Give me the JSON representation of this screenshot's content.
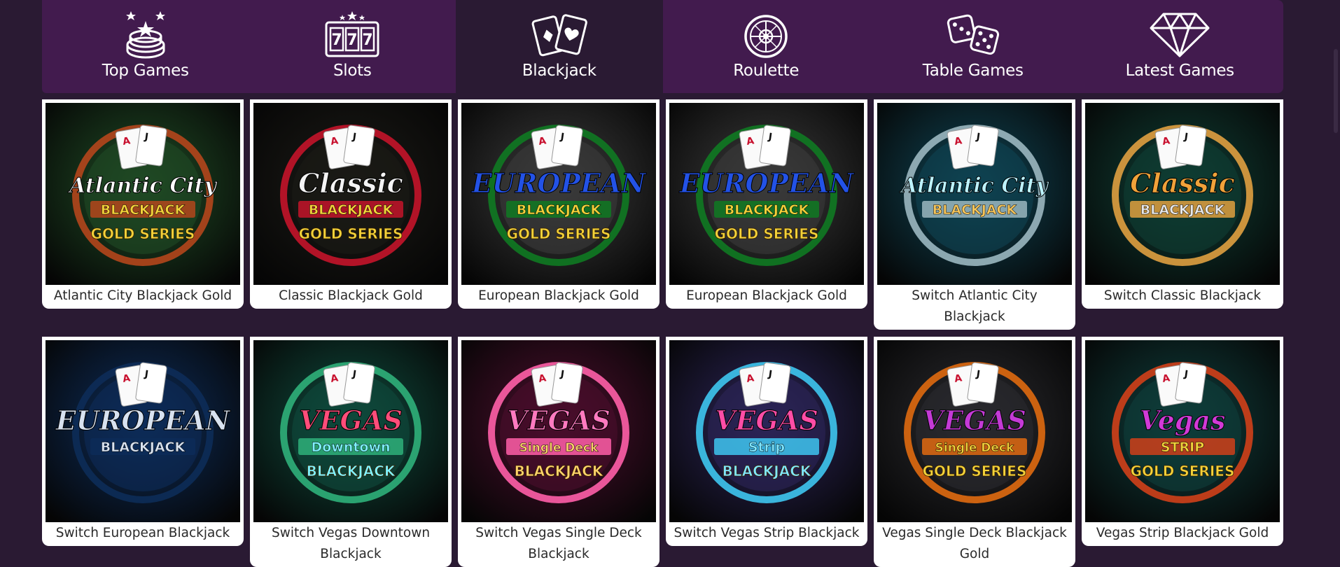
{
  "nav": {
    "tabs": [
      {
        "label": "Top Games",
        "icon": "poker-chips-icon",
        "active": false
      },
      {
        "label": "Slots",
        "icon": "slot-777-icon",
        "active": false
      },
      {
        "label": "Blackjack",
        "icon": "playing-cards-icon",
        "active": true
      },
      {
        "label": "Roulette",
        "icon": "roulette-wheel-icon",
        "active": false
      },
      {
        "label": "Table Games",
        "icon": "dice-icon",
        "active": false
      },
      {
        "label": "Latest Games",
        "icon": "diamond-icon",
        "active": false
      }
    ]
  },
  "games": [
    {
      "title": "Atlantic City Blackjack Gold",
      "art": {
        "line1": "Atlantic City",
        "line2": "BLACKJACK",
        "line3": "GOLD SERIES",
        "bg": "#1f4a24",
        "ring": "#b4461c",
        "color1": "#ffffff",
        "color2": "#f3d23a"
      }
    },
    {
      "title": "Classic Blackjack Gold",
      "art": {
        "line1": "Classic",
        "line2": "BLACKJACK",
        "line3": "GOLD SERIES",
        "bg": "#1b1a16",
        "ring": "#c4142a",
        "color1": "#f4f4f4",
        "color2": "#f3d23a"
      }
    },
    {
      "title": "European Blackjack Gold",
      "art": {
        "line1": "EUROPEAN",
        "line2": "BLACKJACK",
        "line3": "GOLD SERIES",
        "bg": "#3a3a3a",
        "ring": "#0f7a22",
        "color1": "#2352e6",
        "color2": "#f3d23a"
      }
    },
    {
      "title": "European Blackjack Gold",
      "art": {
        "line1": "EUROPEAN",
        "line2": "BLACKJACK",
        "line3": "GOLD SERIES",
        "bg": "#3a3a3a",
        "ring": "#0f7a22",
        "color1": "#2352e6",
        "color2": "#f3d23a"
      }
    },
    {
      "title": "Switch Atlantic City Blackjack",
      "art": {
        "line1": "Atlantic City",
        "line2": "BLACKJACK",
        "line3": "",
        "bg": "#0f4352",
        "ring": "#9bb7c0",
        "color1": "#bdf3ff",
        "color2": "#f6c55a"
      }
    },
    {
      "title": "Switch Classic Blackjack",
      "art": {
        "line1": "Classic",
        "line2": "BLACKJACK",
        "line3": "",
        "bg": "#0f3d33",
        "ring": "#e0a040",
        "color1": "#f0a23a",
        "color2": "#e8e8e8"
      }
    },
    {
      "title": "Switch European Blackjack",
      "art": {
        "line1": "EUROPEAN",
        "line2": "BLACKJACK",
        "line3": "",
        "bg": "#0d2c58",
        "ring": "#0d2c58",
        "color1": "#d8e2f0",
        "color2": "#d8e2f0"
      }
    },
    {
      "title": "Switch Vegas Downtown Blackjack",
      "art": {
        "line1": "VEGAS",
        "line2": "Downtown",
        "line3": "BLACKJACK",
        "bg": "#0f4a3c",
        "ring": "#2fb07a",
        "color1": "#ff4d7a",
        "color2": "#7ff3ff"
      }
    },
    {
      "title": "Switch Vegas Single Deck Blackjack",
      "art": {
        "line1": "VEGAS",
        "line2": "Single Deck",
        "line3": "BLACKJACK",
        "bg": "#4a0e2c",
        "ring": "#ff5fa8",
        "color1": "#ff7ac0",
        "color2": "#ffd36b"
      }
    },
    {
      "title": "Switch Vegas Strip Blackjack",
      "art": {
        "line1": "VEGAS",
        "line2": "Strip",
        "line3": "BLACKJACK",
        "bg": "#2b2456",
        "ring": "#3ec6f0",
        "color1": "#ff4da6",
        "color2": "#7fe6ff"
      }
    },
    {
      "title": "Vegas Single Deck Blackjack Gold",
      "art": {
        "line1": "VEGAS",
        "line2": "Single Deck",
        "line3": "GOLD SERIES",
        "bg": "#2a2a2e",
        "ring": "#e06a10",
        "color1": "#c43ad6",
        "color2": "#f3d23a"
      }
    },
    {
      "title": "Vegas Strip Blackjack Gold",
      "art": {
        "line1": "Vegas",
        "line2": "STRIP",
        "line3": "GOLD SERIES",
        "bg": "#0f3d3b",
        "ring": "#d0401a",
        "color1": "#d23ad8",
        "color2": "#f3d23a"
      }
    }
  ]
}
